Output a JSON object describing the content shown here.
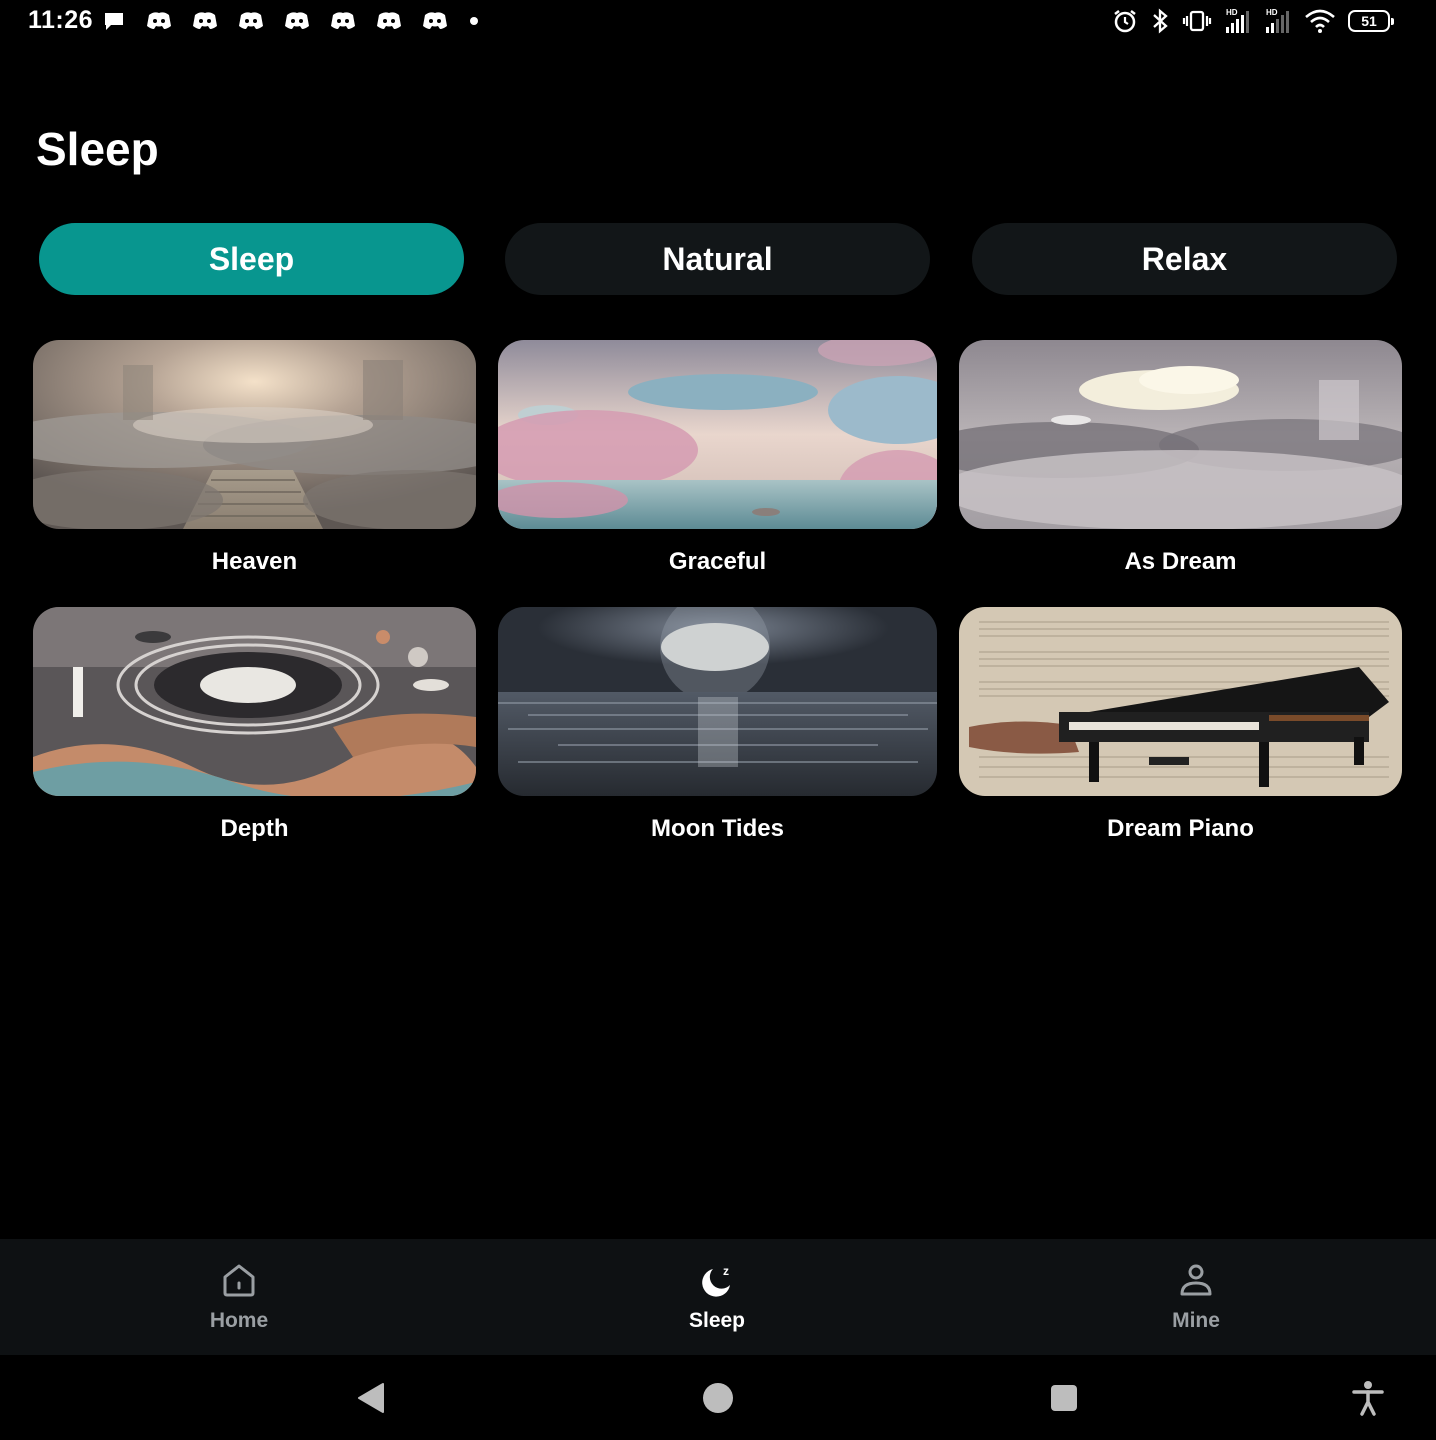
{
  "status_bar": {
    "time": "11:26",
    "notification_icons": [
      "chat-bubble-icon",
      "discord-icon",
      "discord-icon",
      "discord-icon",
      "discord-icon",
      "discord-icon",
      "discord-icon",
      "discord-icon",
      "dot-icon"
    ],
    "battery_level": "51",
    "right_icons": [
      "alarm-icon",
      "bluetooth-icon",
      "vibrate-icon",
      "signal-hd-icon",
      "signal-hd-icon",
      "wifi-icon",
      "battery-icon"
    ]
  },
  "header": {
    "title": "Sleep"
  },
  "tabs": [
    {
      "label": "Sleep",
      "active": true
    },
    {
      "label": "Natural",
      "active": false
    },
    {
      "label": "Relax",
      "active": false
    }
  ],
  "sounds": [
    {
      "label": "Heaven"
    },
    {
      "label": "Graceful"
    },
    {
      "label": "As Dream"
    },
    {
      "label": "Depth"
    },
    {
      "label": "Moon Tides"
    },
    {
      "label": "Dream Piano"
    }
  ],
  "bottom_nav": [
    {
      "label": "Home",
      "icon": "home-icon",
      "active": false
    },
    {
      "label": "Sleep",
      "icon": "moon-sleep-icon",
      "active": true
    },
    {
      "label": "Mine",
      "icon": "person-icon",
      "active": false
    }
  ],
  "system_nav": [
    "back-icon",
    "home-circle-icon",
    "recents-icon",
    "accessibility-icon"
  ],
  "colors": {
    "accent": "#08968f",
    "tab_inactive": "#121618",
    "background": "#000000",
    "bottom_nav": "#0e1113"
  }
}
